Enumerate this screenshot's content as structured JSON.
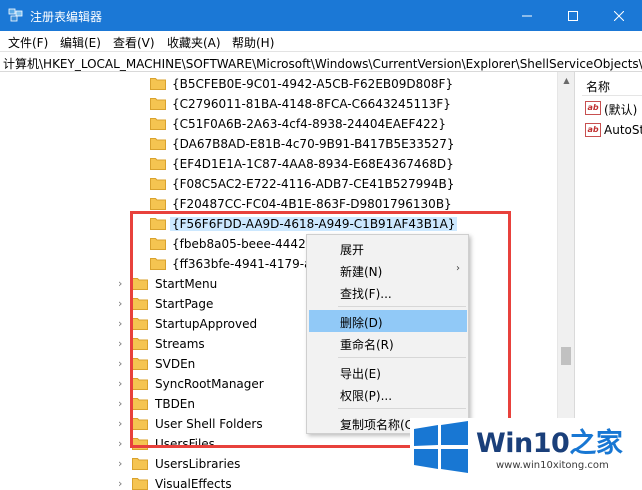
{
  "window": {
    "title": "注册表编辑器"
  },
  "menu": [
    "文件(F)",
    "编辑(E)",
    "查看(V)",
    "收藏夹(A)",
    "帮助(H)"
  ],
  "address": "计算机\\HKEY_LOCAL_MACHINE\\SOFTWARE\\Microsoft\\Windows\\CurrentVersion\\Explorer\\ShellServiceObjects\\",
  "tree": {
    "guid_items": [
      "{B5CFEB0E-9C01-4942-A5CB-F62EB09D808F}",
      "{C2796011-81BA-4148-8FCA-C6643245113F}",
      "{C51F0A6B-2A63-4cf4-8938-24404EAEF422}",
      "{DA67B8AD-E81B-4c70-9B91-B417B5E33527}",
      "{EF4D1E1A-1C87-4AA8-8934-E68E4367468D}",
      "{F08C5AC2-E722-4116-ADB7-CE41B527994B}",
      "{F20487CC-FC04-4B1E-863F-D9801796130B}",
      "{F56F6FDD-AA9D-4618-A949-C1B91AF43B1A}",
      "{fbeb8a05-beee-4442-8",
      "{ff363bfe-4941-4179-a8"
    ],
    "selected_index": 7,
    "key_items": [
      "StartMenu",
      "StartPage",
      "StartupApproved",
      "Streams",
      "SVDEn",
      "SyncRootManager",
      "TBDEn",
      "User Shell Folders",
      "UsersFiles",
      "UsersLibraries",
      "VisualEffects"
    ]
  },
  "values_pane": {
    "column_header": "名称",
    "values": [
      {
        "icon": "ab-string-icon",
        "name": "(默认)"
      },
      {
        "icon": "ab-string-icon",
        "name": "AutoSt"
      }
    ]
  },
  "context_menu": {
    "items": [
      {
        "label": "展开",
        "hover": false,
        "submenu": false
      },
      {
        "label": "新建(N)",
        "hover": false,
        "submenu": true
      },
      {
        "label": "查找(F)...",
        "hover": false,
        "submenu": false
      },
      {
        "separator": true
      },
      {
        "label": "删除(D)",
        "hover": true,
        "submenu": false
      },
      {
        "label": "重命名(R)",
        "hover": false,
        "submenu": false
      },
      {
        "separator": true
      },
      {
        "label": "导出(E)",
        "hover": false,
        "submenu": false
      },
      {
        "label": "权限(P)...",
        "hover": false,
        "submenu": false
      },
      {
        "separator": true
      },
      {
        "label": "复制项名称(C)",
        "hover": false,
        "submenu": false
      }
    ]
  },
  "watermark": {
    "brand_prefix": "Win10",
    "brand_suffix": "之家",
    "url": "www.win10xitong.com"
  },
  "colors": {
    "titlebar": "#1b78d6",
    "selection": "#cce8ff",
    "menu_hover": "#91c9f7",
    "highlight_border": "#e8413c",
    "folder": "#f5c451"
  }
}
